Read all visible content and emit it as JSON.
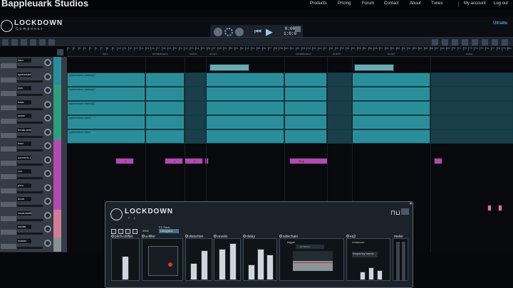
{
  "site": {
    "brand": "Bappleuark Studios"
  },
  "nav": {
    "links": [
      "Products",
      "Pricing",
      "Forum",
      "Contact",
      "About",
      "Tunes"
    ],
    "my_account": "My account",
    "logout": "Log out"
  },
  "app": {
    "logo_title": "LOCKDOWN",
    "logo_subtitle": "Composer",
    "edition": "Ultralite"
  },
  "transport": {
    "time_top": "0:00",
    "time_bottom": "1:0:0"
  },
  "timeline": {
    "bar_numbers": [
      "1",
      "2",
      "3",
      "4",
      "5",
      "6",
      "7",
      "8",
      "9",
      "10",
      "11",
      "12",
      "13",
      "14",
      "15",
      "16",
      "17",
      "18",
      "19",
      "20",
      "21",
      "22",
      "23",
      "24",
      "25",
      "26",
      "27",
      "28",
      "29",
      "30",
      "31",
      "32",
      "33",
      "34",
      "35",
      "36",
      "37",
      "38",
      "39",
      "40",
      "41",
      "42",
      "43",
      "44",
      "45",
      "46",
      "47",
      "48",
      "49",
      "50",
      "51",
      "52",
      "53",
      "54",
      "55",
      "56",
      "57",
      "58",
      "59",
      "60",
      "61",
      "62",
      "63",
      "64",
      "65",
      "66",
      "67",
      "68",
      "69",
      "70",
      "71",
      "72",
      "73",
      "74",
      "75",
      "76",
      "77",
      "78",
      "79",
      "80"
    ],
    "sections": [
      "intro",
      "breakdown1",
      "build1",
      "drop1",
      "breakdown2",
      "build2",
      "drop2",
      "outro"
    ]
  },
  "tracks": [
    {
      "name": "intro",
      "color": "#2a8e9a"
    },
    {
      "name": "synthesizer",
      "color": "#2a8e9a"
    },
    {
      "name": "kick",
      "color": "#2aa07f"
    },
    {
      "name": "bass",
      "color": "#2aa07f"
    },
    {
      "name": "snare",
      "color": "#2aa07f"
    },
    {
      "name": "break-wobble",
      "color": "#2aa07f"
    },
    {
      "name": "lead",
      "color": "#b04cb1"
    },
    {
      "name": "sound-fx-1",
      "color": "#b04cb1"
    },
    {
      "name": "vox",
      "color": "#b04cb1"
    },
    {
      "name": "perc",
      "color": "#b04cb1"
    },
    {
      "name": "drum",
      "color": "#b04cb1"
    },
    {
      "name": "vocal-build",
      "color": "#d47a9a"
    },
    {
      "name": "vocals",
      "color": "#d47a9a"
    },
    {
      "name": "master",
      "color": "#8a8f95"
    }
  ],
  "clips": {
    "audio_labels": [
      "synthesizer-melody3",
      "synthesizer-melody2",
      "synthesizer-melody1",
      "synthesizer-lead1",
      "synthesizer-bass"
    ],
    "midi_labels": [
      "1",
      "1",
      "1",
      "1",
      "drop",
      "1"
    ]
  },
  "fx": {
    "logo_title": "LOCKDOWN",
    "logo_subtitle": "F X",
    "name": "FX Rack",
    "preset": "Disrupted",
    "number": "0002",
    "modules": [
      "pitch-shifter",
      "a-filter",
      "distortion",
      "reverb",
      "delay",
      "sidechain",
      "eq3",
      "meter"
    ],
    "sidechain_trigger": "trigger",
    "sidechain_source": "phrases",
    "eq_crossover": "crossover",
    "eq_bands": "frequency bands"
  }
}
